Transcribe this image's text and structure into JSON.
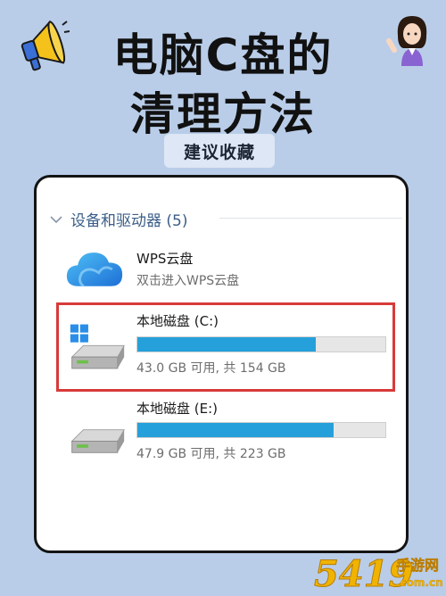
{
  "header": {
    "title_line1": "电脑C盘的",
    "title_line2": "清理方法",
    "tag": "建议收藏"
  },
  "explorer": {
    "section_label": "设备和驱动器 (5)",
    "drives": [
      {
        "name": "WPS云盘",
        "subtitle": "双击进入WPS云盘",
        "icon": "cloud-icon"
      },
      {
        "name": "本地磁盘 (C:)",
        "subtitle": "43.0 GB 可用, 共 154 GB",
        "used_fraction": 0.72,
        "icon": "windows-drive-icon",
        "highlighted": true
      },
      {
        "name": "本地磁盘 (E:)",
        "subtitle": "47.9 GB 可用, 共 223 GB",
        "used_fraction": 0.79,
        "icon": "hard-drive-icon"
      }
    ]
  },
  "watermark": {
    "number": "5419",
    "name": "手游网",
    "url": ".com.cn"
  },
  "colors": {
    "background": "#b9cde9",
    "bar_fill": "#26a0da",
    "highlight": "#d83a3a"
  }
}
